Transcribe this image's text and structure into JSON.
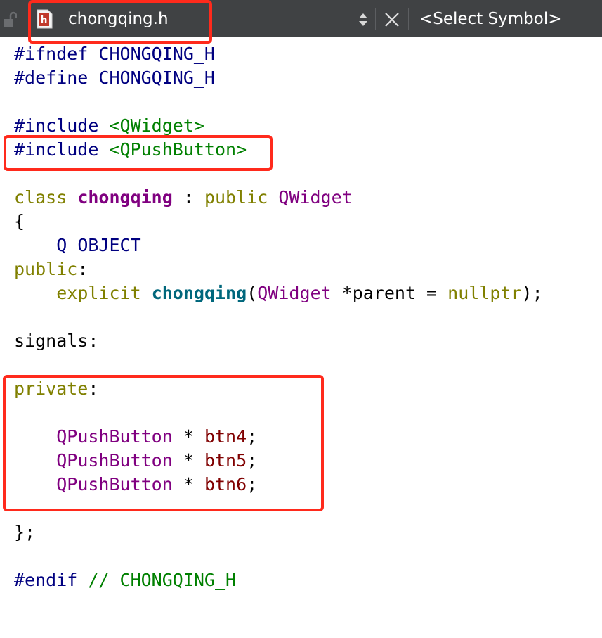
{
  "toolbar": {
    "file_name": "chongqing.h",
    "symbol_select": "<Select Symbol>",
    "colors": {
      "background": "#404244",
      "file_icon": "#c0392b",
      "highlight": "#ff2a1c"
    }
  },
  "code": {
    "lines": [
      {
        "tokens": [
          {
            "t": "#ifndef CHONGQING_H",
            "c": "pp"
          }
        ]
      },
      {
        "tokens": [
          {
            "t": "#define CHONGQING_H",
            "c": "pp"
          }
        ]
      },
      {
        "tokens": []
      },
      {
        "tokens": [
          {
            "t": "#include ",
            "c": "pp"
          },
          {
            "t": "<QWidget>",
            "c": "str"
          }
        ]
      },
      {
        "tokens": [
          {
            "t": "#include ",
            "c": "pp"
          },
          {
            "t": "<QPushButton>",
            "c": "str"
          }
        ]
      },
      {
        "tokens": []
      },
      {
        "tokens": [
          {
            "t": "class",
            "c": "kw"
          },
          {
            "t": " "
          },
          {
            "t": "chongqing",
            "c": "cls"
          },
          {
            "t": " : "
          },
          {
            "t": "public",
            "c": "kw"
          },
          {
            "t": " "
          },
          {
            "t": "QWidget",
            "c": "type"
          }
        ]
      },
      {
        "tokens": [
          {
            "t": "{"
          }
        ]
      },
      {
        "tokens": [
          {
            "t": "    "
          },
          {
            "t": "Q_OBJECT",
            "c": "mac"
          }
        ]
      },
      {
        "tokens": [
          {
            "t": "public",
            "c": "kw"
          },
          {
            "t": ":"
          }
        ]
      },
      {
        "tokens": [
          {
            "t": "    "
          },
          {
            "t": "explicit",
            "c": "kw"
          },
          {
            "t": " "
          },
          {
            "t": "chongqing",
            "c": "fn"
          },
          {
            "t": "("
          },
          {
            "t": "QWidget",
            "c": "type"
          },
          {
            "t": " *parent = "
          },
          {
            "t": "nullptr",
            "c": "kw"
          },
          {
            "t": ");"
          }
        ]
      },
      {
        "tokens": []
      },
      {
        "tokens": [
          {
            "t": "signals:"
          }
        ]
      },
      {
        "tokens": []
      },
      {
        "tokens": [
          {
            "t": "private",
            "c": "kw"
          },
          {
            "t": ":"
          }
        ]
      },
      {
        "tokens": []
      },
      {
        "tokens": [
          {
            "t": "    "
          },
          {
            "t": "QPushButton",
            "c": "type"
          },
          {
            "t": " * "
          },
          {
            "t": "btn4",
            "c": "var"
          },
          {
            "t": ";"
          }
        ]
      },
      {
        "tokens": [
          {
            "t": "    "
          },
          {
            "t": "QPushButton",
            "c": "type"
          },
          {
            "t": " * "
          },
          {
            "t": "btn5",
            "c": "var"
          },
          {
            "t": ";"
          }
        ]
      },
      {
        "tokens": [
          {
            "t": "    "
          },
          {
            "t": "QPushButton",
            "c": "type"
          },
          {
            "t": " * "
          },
          {
            "t": "btn6",
            "c": "var"
          },
          {
            "t": ";"
          }
        ]
      },
      {
        "tokens": []
      },
      {
        "tokens": [
          {
            "t": "};"
          }
        ]
      },
      {
        "tokens": []
      },
      {
        "tokens": [
          {
            "t": "#endif",
            "c": "pp"
          },
          {
            "t": " // CHONGQING_H",
            "c": "cmt"
          }
        ]
      }
    ]
  }
}
